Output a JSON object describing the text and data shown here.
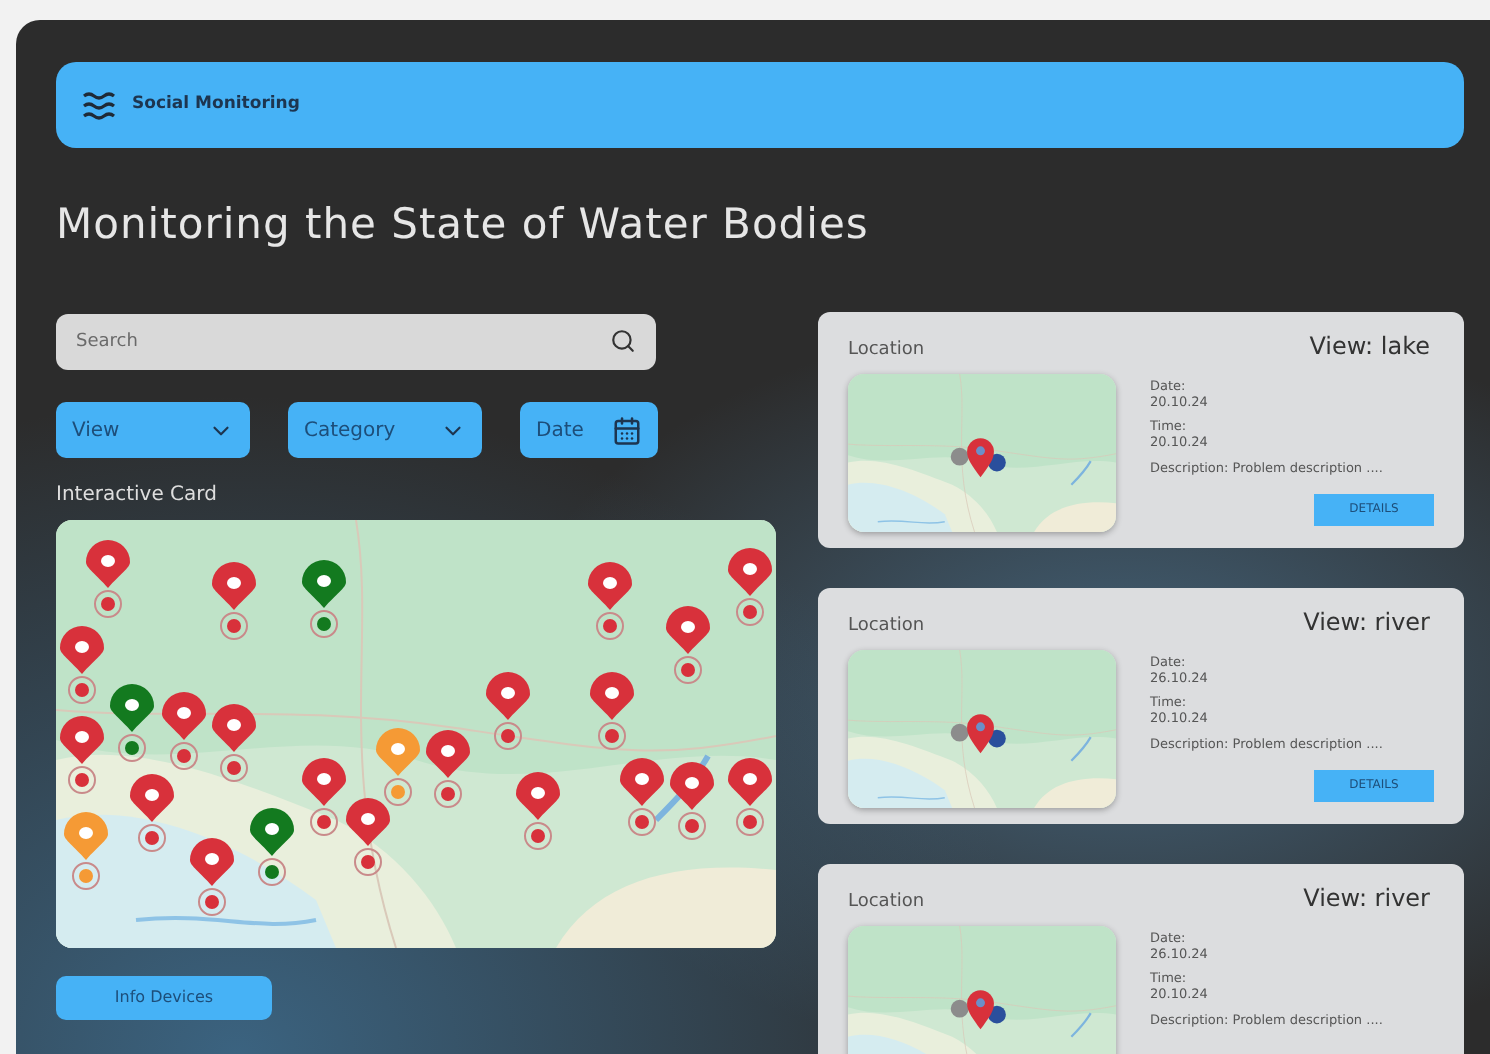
{
  "header": {
    "brand": "Social Monitoring"
  },
  "title": "Monitoring the State of Water Bodies",
  "search": {
    "placeholder": "Search"
  },
  "filters": [
    {
      "kind": "dropdown",
      "label": "View"
    },
    {
      "kind": "dropdown",
      "label": "Category"
    },
    {
      "kind": "date",
      "label": "Date"
    }
  ],
  "map": {
    "label": "Interactive Card",
    "pins": [
      {
        "color": "#d8313b"
      },
      {
        "color": "#d8313b"
      },
      {
        "color": "#137a1f"
      },
      {
        "color": "#d8313b"
      },
      {
        "color": "#d8313b"
      },
      {
        "color": "#d8313b"
      },
      {
        "color": "#d8313b"
      },
      {
        "color": "#137a1f"
      },
      {
        "color": "#d8313b"
      },
      {
        "color": "#d8313b"
      },
      {
        "color": "#d8313b"
      },
      {
        "color": "#d8313b"
      },
      {
        "color": "#d8313b"
      },
      {
        "color": "#f59a35"
      },
      {
        "color": "#d8313b"
      },
      {
        "color": "#d8313b"
      },
      {
        "color": "#d8313b"
      },
      {
        "color": "#d8313b"
      },
      {
        "color": "#d8313b"
      },
      {
        "color": "#d8313b"
      },
      {
        "color": "#d8313b"
      },
      {
        "color": "#f59a35"
      },
      {
        "color": "#137a1f"
      },
      {
        "color": "#d8313b"
      },
      {
        "color": "#d8313b"
      }
    ]
  },
  "info_button": "Info Devices",
  "reports": [
    {
      "location_label": "Location",
      "view": "View: lake",
      "date_label": "Date:",
      "date": "20.10.24",
      "time_label": "Time:",
      "time": "20.10.24",
      "description": "Description: Problem description ....",
      "button": "DETAILS"
    },
    {
      "location_label": "Location",
      "view": "View: river",
      "date_label": "Date:",
      "date": "26.10.24",
      "time_label": "Time:",
      "time": "20.10.24",
      "description": "Description: Problem description ....",
      "button": "DETAILS"
    },
    {
      "location_label": "Location",
      "view": "View: river",
      "date_label": "Date:",
      "date": "26.10.24",
      "time_label": "Time:",
      "time": "20.10.24",
      "description": "Description: Problem description ...."
    }
  ]
}
